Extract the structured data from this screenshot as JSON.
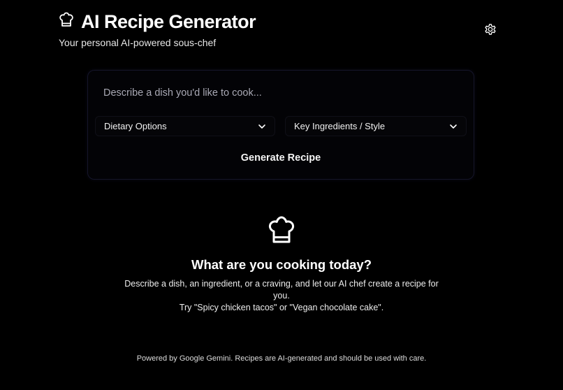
{
  "header": {
    "title": "AI Recipe Generator",
    "subtitle": "Your personal AI-powered sous-chef",
    "logo_icon": "chef-hat-icon",
    "settings_icon": "gear-icon"
  },
  "form": {
    "prompt_placeholder": "Describe a dish you'd like to cook...",
    "prompt_value": "",
    "dietary_select_label": "Dietary Options",
    "ingredients_select_label": "Key Ingredients / Style",
    "generate_button_label": "Generate Recipe"
  },
  "empty_state": {
    "icon": "chef-hat-icon",
    "title": "What are you cooking today?",
    "description": "Describe a dish, an ingredient, or a craving, and let our AI chef create a recipe for you.",
    "suggestion": "Try \"Spicy chicken tacos\" or \"Vegan chocolate cake\"."
  },
  "footer": {
    "text": "Powered by Google Gemini. Recipes are AI-generated and should be used with care."
  },
  "colors": {
    "background": "#000000",
    "text": "#ffffff",
    "placeholder": "#a9a9b4",
    "card_border": "#15152a"
  }
}
